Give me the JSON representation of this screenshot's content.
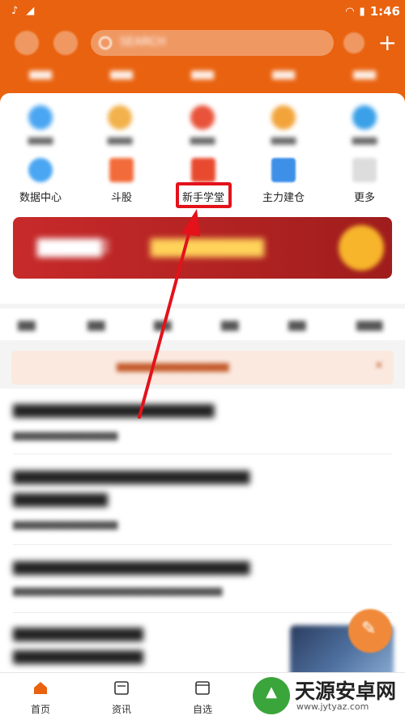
{
  "status": {
    "left_icons": [
      "tiktok-icon",
      "signal-icon"
    ],
    "time": "1:46"
  },
  "header": {
    "search_placeholder": "SEARCH"
  },
  "menu": {
    "row2": [
      {
        "label": "数据中心",
        "icon": "data-center-icon",
        "color": "#4aa6f2"
      },
      {
        "label": "斗股",
        "icon": "dougu-icon",
        "color": "#f26b3a"
      },
      {
        "label": "新手学堂",
        "icon": "novice-school-icon",
        "color": "#e84a2f"
      },
      {
        "label": "主力建仓",
        "icon": "main-force-icon",
        "color": "#3d8fe8"
      },
      {
        "label": "更多",
        "icon": "more-icon",
        "color": "#cccccc"
      }
    ]
  },
  "bottom_nav": [
    {
      "label": "首页",
      "icon": "home-icon"
    },
    {
      "label": "资讯",
      "icon": "news-icon"
    },
    {
      "label": "自选",
      "icon": "watchlist-icon"
    }
  ],
  "watermark": {
    "name": "天源安卓网",
    "url": "www.jytyaz.com"
  },
  "colors": {
    "brand": "#e9620f",
    "highlight": "#e3121b"
  }
}
